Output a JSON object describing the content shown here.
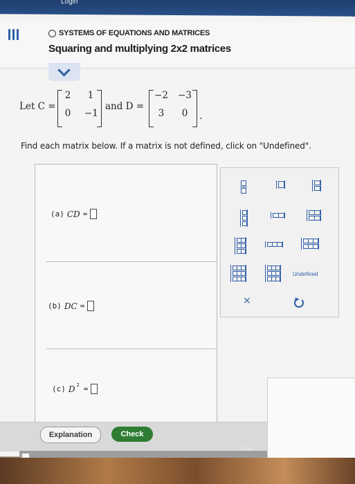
{
  "topbar": {
    "login_label": "Login"
  },
  "header": {
    "subtitle": "SYSTEMS OF EQUATIONS AND MATRICES",
    "title": "Squaring and multiplying 2x2 matrices"
  },
  "problem": {
    "let_label": "Let C =",
    "and_label": "and D =",
    "C": [
      "2",
      "1",
      "0",
      "−1"
    ],
    "D": [
      "−2",
      "−3",
      "3",
      "0"
    ],
    "period": "."
  },
  "instruction": "Find each matrix below. If a matrix is not defined, click on \"Undefined\".",
  "answers": [
    {
      "prefix": "(a)",
      "expr": "CD",
      "eq": "="
    },
    {
      "prefix": "(b)",
      "expr": "DC",
      "eq": "="
    },
    {
      "prefix": "(c)",
      "expr": "D",
      "sup": "2",
      "eq": "="
    }
  ],
  "palette": {
    "undefined_label": "Undefined",
    "times_label": "×"
  },
  "footer": {
    "explanation_label": "Explanation",
    "check_label": "Check",
    "copyright": "© 202"
  },
  "colors": {
    "accent": "#2f5ea8",
    "check_green": "#2e7d32"
  }
}
